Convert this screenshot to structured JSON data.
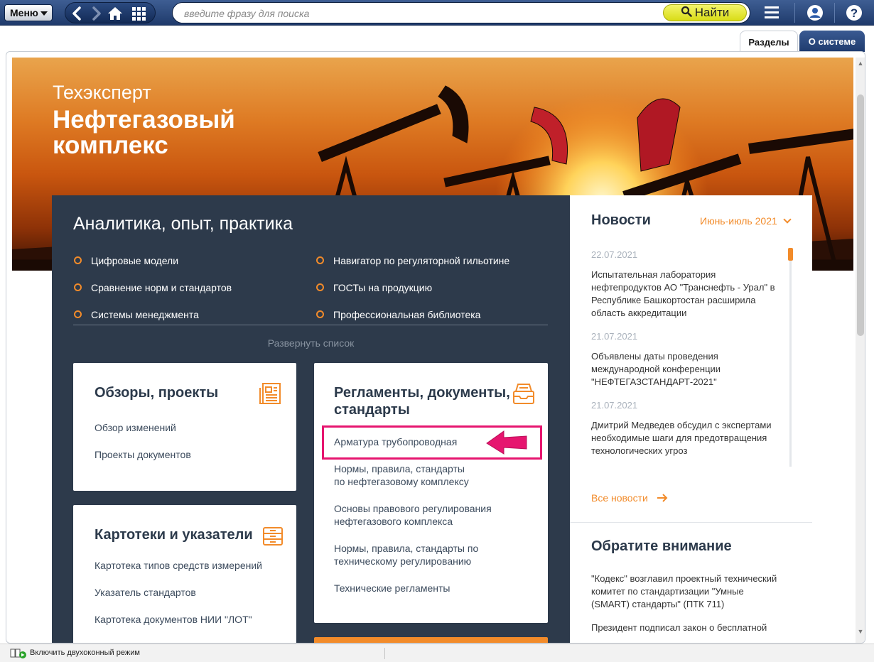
{
  "toolbar": {
    "menu_label": "Меню",
    "search_placeholder": "введите фразу для поиска",
    "find_label": "Найти",
    "icons": [
      "back-icon",
      "forward-icon",
      "home-icon",
      "grid-icon",
      "hamburger-icon",
      "user-icon",
      "help-icon"
    ]
  },
  "tabs": [
    {
      "label": "Разделы",
      "active": true
    },
    {
      "label": "О системе",
      "active": false
    }
  ],
  "hero": {
    "brand": "Техэксперт",
    "title": "Нефтегазовый комплекс"
  },
  "analytics": {
    "title": "Аналитика, опыт, практика",
    "links": [
      "Цифровые модели",
      "Навигатор по регуляторной гильотине",
      "Сравнение норм и стандартов",
      "ГОСТы на продукцию",
      "Системы менеджмента",
      "Профессиональная библиотека"
    ],
    "expand_label": "Развернуть список"
  },
  "reviews": {
    "title": "Обзоры, проекты",
    "links": [
      "Обзор изменений",
      "Проекты документов"
    ]
  },
  "catalogs": {
    "title": "Картотеки и указатели",
    "links": [
      "Картотека типов средств измерений",
      "Указатель стандартов",
      "Картотека документов НИИ \"ЛОТ\""
    ]
  },
  "regulations": {
    "title": "Регламенты, документы, стандарты",
    "links": [
      "Арматура трубопроводная",
      "Нормы, правила, стандарты по нефтегазовому комплексу",
      "Основы правового регулирования нефтегазового комплекса",
      "Нормы, правила, стандарты по техническому регулированию",
      "Технические регламенты"
    ]
  },
  "news": {
    "title": "Новости",
    "period": "Июнь-июль 2021",
    "items": [
      {
        "date": "22.07.2021",
        "text": "Испытательная лаборатория нефтепродуктов АО \"Транснефть - Урал\" в Республике Башкортостан расширила область аккредитации"
      },
      {
        "date": "21.07.2021",
        "text": "Объявлены даты проведения международной конференции \"НЕФТЕГАЗСТАНДАРТ-2021\""
      },
      {
        "date": "21.07.2021",
        "text": "Дмитрий Медведев обсудил с экспертами необходимые шаги для предотвращения технологических угроз"
      }
    ],
    "all_label": "Все новости"
  },
  "attention": {
    "title": "Обратите внимание",
    "items": [
      "\"Кодекс\" возглавил проектный технический комитет по стандартизации \"Умные (SMART) стандарты\" (ПТК 711)",
      "Президент подписал закон о бесплатной"
    ]
  },
  "statusbar": {
    "dual_window_label": "Включить двухоконный режим"
  },
  "colors": {
    "accent": "#f28b2a",
    "panel": "#2d3a4b",
    "highlight": "#e6156f",
    "toolbar": "#1f3a6b"
  }
}
